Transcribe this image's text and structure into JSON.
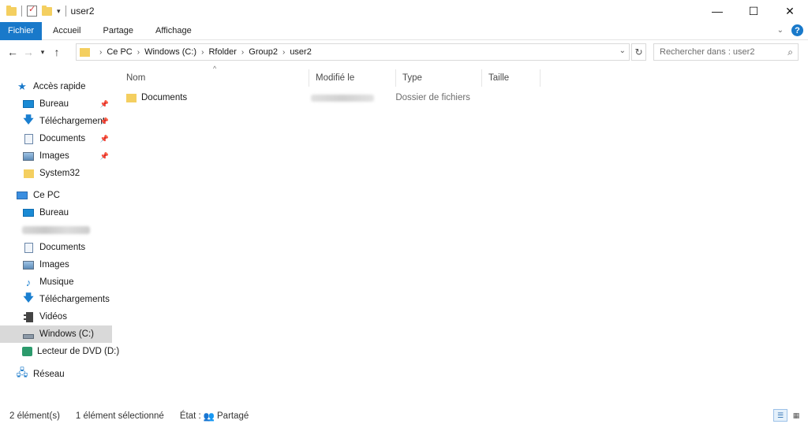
{
  "titlebar": {
    "title": "user2",
    "minimize": "—",
    "maximize": "☐",
    "close": "✕"
  },
  "ribbon": {
    "tabs": [
      "Fichier",
      "Accueil",
      "Partage",
      "Affichage"
    ],
    "help": "?"
  },
  "address": {
    "crumbs": [
      "Ce PC",
      "Windows (C:)",
      "Rfolder",
      "Group2",
      "user2"
    ]
  },
  "search": {
    "placeholder": "Rechercher dans : user2"
  },
  "nav": {
    "quick_access": "Accès rapide",
    "quick_items": [
      "Bureau",
      "Téléchargements",
      "Documents",
      "Images",
      "System32"
    ],
    "this_pc": "Ce PC",
    "pc_items": [
      "Bureau",
      "Documents",
      "Images",
      "Musique",
      "Téléchargements",
      "Vidéos",
      "Windows (C:)",
      "Lecteur de DVD (D:)"
    ],
    "network": "Réseau"
  },
  "columns": [
    "Nom",
    "Modifié le",
    "Type",
    "Taille"
  ],
  "files": [
    {
      "name": "Documents",
      "type": "Dossier de fichiers"
    }
  ],
  "status": {
    "count": "2 élément(s)",
    "selected": "1 élément sélectionné",
    "state_label": "État :",
    "state_value": "Partagé"
  },
  "colors": {
    "accent": "#1979ca",
    "folder": "#f4cf60",
    "selection": "#d9d9d9"
  }
}
